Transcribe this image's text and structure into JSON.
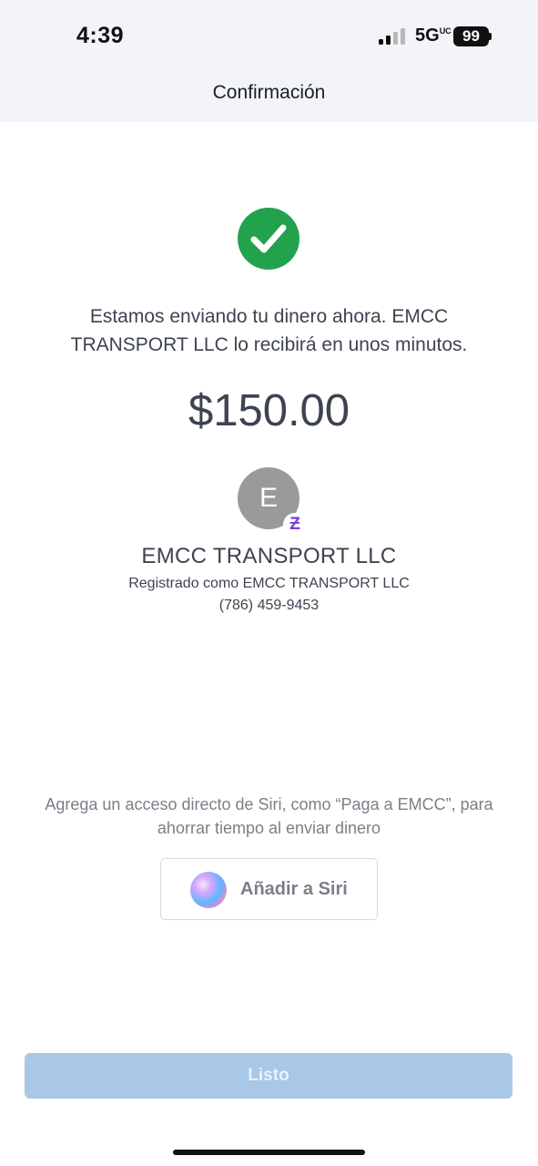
{
  "status_bar": {
    "time": "4:39",
    "network": "5G",
    "network_suffix": "UC",
    "battery": "99",
    "signal_bars_active": 2,
    "signal_bars_total": 4
  },
  "header": {
    "title": "Confirmación"
  },
  "confirmation": {
    "icon": "check-circle-icon",
    "message": "Estamos enviando tu dinero ahora. EMCC TRANSPORT LLC lo recibirá en unos minutos.",
    "amount": "$150.00"
  },
  "recipient": {
    "initial": "E",
    "badge_glyph": "Ƶ",
    "name": "EMCC TRANSPORT LLC",
    "registered_as": "Registrado como EMCC TRANSPORT LLC",
    "phone": "(786) 459-9453"
  },
  "siri": {
    "prompt": "Agrega un acceso directo de Siri, como “Paga a EMCC”, para ahorrar tiempo al enviar dinero",
    "button_label": "Añadir a Siri"
  },
  "footer": {
    "done_label": "Listo"
  },
  "colors": {
    "success": "#23a24d",
    "zelle_purple": "#7a3fd6",
    "done_button": "#a9c7e6",
    "header_bg": "#f2f4f7"
  }
}
